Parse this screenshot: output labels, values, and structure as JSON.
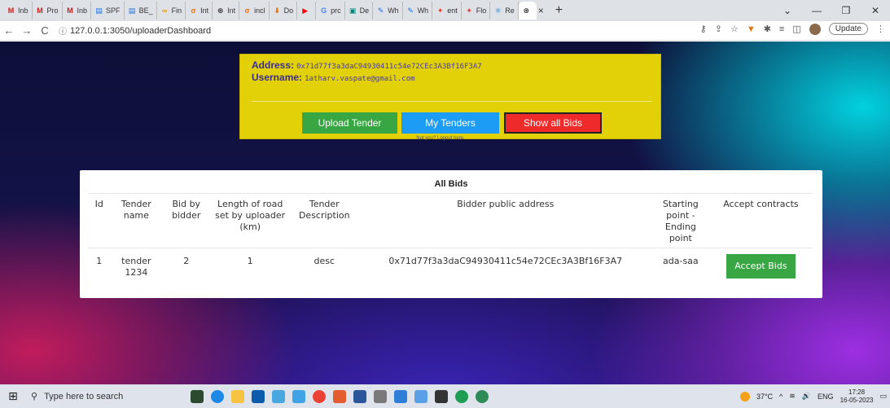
{
  "browser": {
    "tabs": [
      {
        "label": "Inb",
        "icon": "gmail-icon",
        "color": "#c5221f",
        "glyph": "M"
      },
      {
        "label": "Pro",
        "icon": "gmail-icon",
        "color": "#c5221f",
        "glyph": "M"
      },
      {
        "label": "Inb",
        "icon": "gmail-icon",
        "color": "#c5221f",
        "glyph": "M"
      },
      {
        "label": "SPF",
        "icon": "docs-icon",
        "color": "#1a73e8",
        "glyph": "▤"
      },
      {
        "label": "BE_",
        "icon": "docs-icon",
        "color": "#1a73e8",
        "glyph": "▤"
      },
      {
        "label": "Fin",
        "icon": "colab-icon",
        "color": "#f29900",
        "glyph": "∞"
      },
      {
        "label": "Int",
        "icon": "sigma-icon",
        "color": "#e8710a",
        "glyph": "σ"
      },
      {
        "label": "Int",
        "icon": "chatgpt-icon",
        "color": "#333333",
        "glyph": "⊛"
      },
      {
        "label": "incl",
        "icon": "sigma-icon",
        "color": "#e8710a",
        "glyph": "σ"
      },
      {
        "label": "Do",
        "icon": "download-icon",
        "color": "#e8710a",
        "glyph": "⬇"
      },
      {
        "label": "",
        "icon": "youtube-icon",
        "color": "#ff0000",
        "glyph": "▶"
      },
      {
        "label": "prc",
        "icon": "google-icon",
        "color": "#4285f4",
        "glyph": "G"
      },
      {
        "label": "De",
        "icon": "meet-icon",
        "color": "#00897b",
        "glyph": "▣"
      },
      {
        "label": "Wh",
        "icon": "pen-icon",
        "color": "#1a73e8",
        "glyph": "✎"
      },
      {
        "label": "Wh",
        "icon": "pen-icon",
        "color": "#1a73e8",
        "glyph": "✎"
      },
      {
        "label": "ent",
        "icon": "pieces-icon",
        "color": "#e53935",
        "glyph": "✦"
      },
      {
        "label": "Flo",
        "icon": "pieces-icon",
        "color": "#e53935",
        "glyph": "✦"
      },
      {
        "label": "Re",
        "icon": "react-icon",
        "color": "#1976d2",
        "glyph": "⚛"
      }
    ],
    "active_tab_icon": "chatgpt-icon",
    "url": "127.0.0.1:3050/uploaderDashboard",
    "update_label": "Update"
  },
  "dashboard": {
    "address_label": "Address:",
    "address_value": "0x71d77f3a3daC94930411c54e72CEc3A3Bf16F3A7",
    "username_label": "Username:",
    "username_value": "1atharv.vaspate@gmail.com",
    "buttons": {
      "upload": "Upload Tender",
      "my_tenders": "My Tenders",
      "show_bids": "Show all Bids"
    },
    "logout_text": "Not you? Logout here.",
    "colors": {
      "card": "#e2d107",
      "upload": "#38a743",
      "my_tenders": "#1d9cf5",
      "show_bids": "#ee2a2a"
    }
  },
  "bids": {
    "title": "All Bids",
    "headers": [
      "Id",
      "Tender name",
      "Bid by bidder",
      "Length of road set by uploader (km)",
      "Tender Description",
      "Bidder public address",
      "Starting point - Ending point",
      "Accept contracts"
    ],
    "rows": [
      {
        "id": "1",
        "tender_name": "tender 1234",
        "bid": "2",
        "length": "1",
        "description": "desc",
        "address": "0x71d77f3a3daC94930411c54e72CEc3A3Bf16F3A7",
        "route": "ada-saa",
        "action": "Accept Bids"
      }
    ]
  },
  "taskbar": {
    "search_placeholder": "Type here to search",
    "temperature": "37°C",
    "language": "ENG",
    "time": "17:28",
    "date": "16-05-2023"
  }
}
